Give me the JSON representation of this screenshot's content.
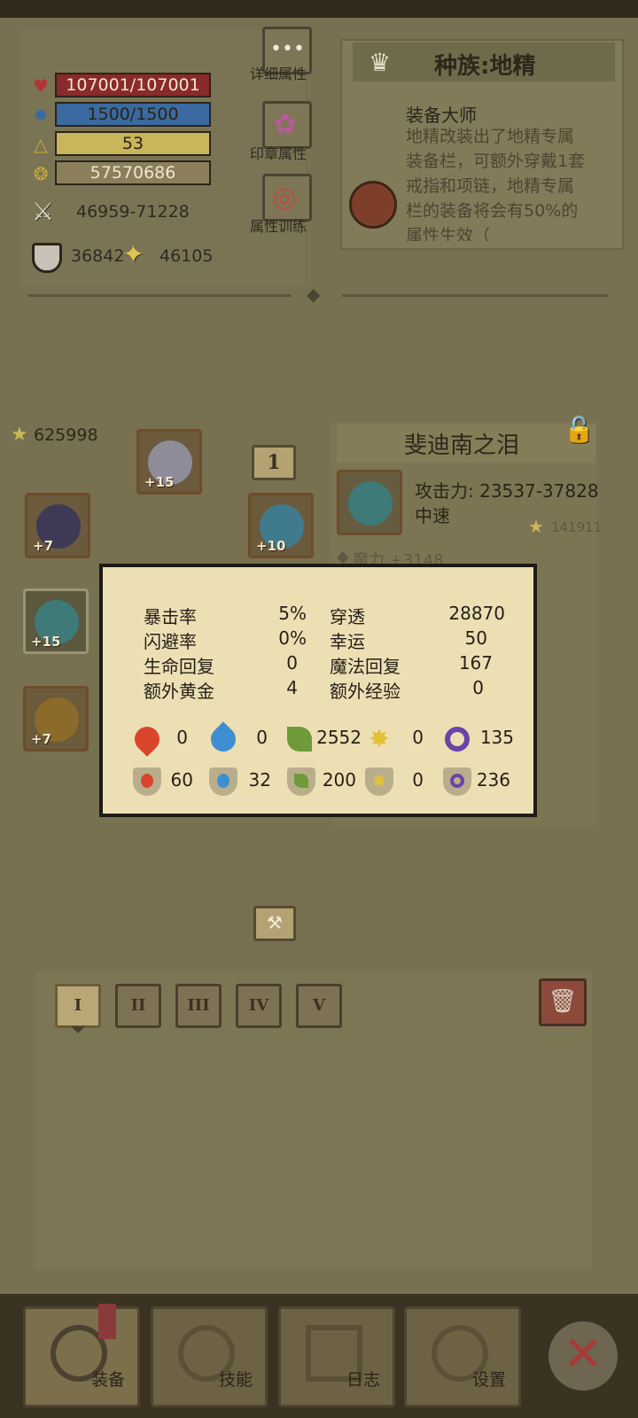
{
  "vitals": {
    "hp": "107001/107001",
    "mp": "1500/1500",
    "level": "53",
    "gold": "57570686",
    "attack": "46959-71228",
    "armor": "36842",
    "magic_resist": "46105"
  },
  "side_menu": {
    "detailed_label": "详细属性",
    "seal_label": "印章属性",
    "training_label": "属性训练"
  },
  "race": {
    "title": "种族:地精",
    "ability_name": "装备大师",
    "description": "地精改装出了地精专属装备栏，可额外穿戴1套戒指和项链，地精专属栏的装备将会有50%的属性生效（"
  },
  "gear": {
    "power_score": "625998",
    "slots": [
      {
        "name": "crown",
        "level": "+15"
      },
      {
        "name": "ring",
        "level": "+7"
      },
      {
        "name": "amulet",
        "level": "+10"
      },
      {
        "name": "staff",
        "level": "+15"
      },
      {
        "name": "boots",
        "level": "+7"
      }
    ],
    "set_number": "1"
  },
  "item": {
    "name": "斐迪南之泪",
    "attack": "攻击力: 23537-37828",
    "speed": "中速",
    "score": "141911",
    "bonus": "魔力 +3148"
  },
  "popup": {
    "stats": [
      {
        "label": "暴击率",
        "value": "5%",
        "label2": "穿透",
        "value2": "28870"
      },
      {
        "label": "闪避率",
        "value": "0%",
        "label2": "幸运",
        "value2": "50"
      },
      {
        "label": "生命回复",
        "value": "0",
        "label2": "魔法回复",
        "value2": "167"
      },
      {
        "label": "额外黄金",
        "value": "4",
        "label2": "额外经验",
        "value2": "0"
      }
    ],
    "element_damage": [
      {
        "element": "fire",
        "value": "0"
      },
      {
        "element": "water",
        "value": "0"
      },
      {
        "element": "nature",
        "value": "2552"
      },
      {
        "element": "light",
        "value": "0"
      },
      {
        "element": "dark",
        "value": "135"
      }
    ],
    "element_resist": [
      {
        "element": "fire",
        "value": "60"
      },
      {
        "element": "water",
        "value": "32"
      },
      {
        "element": "nature",
        "value": "200"
      },
      {
        "element": "light",
        "value": "0"
      },
      {
        "element": "dark",
        "value": "236"
      }
    ]
  },
  "inventory": {
    "tabs": [
      "I",
      "II",
      "III",
      "IV",
      "V"
    ],
    "selected_tab": "I"
  },
  "bottom_nav": {
    "equip": "装备",
    "skills": "技能",
    "log": "日志",
    "settings": "设置"
  },
  "colors": {
    "hp_bar": "#8a2a2a",
    "mp_bar": "#3a6aa0",
    "xp_bar": "#c9b55a",
    "gold_bar": "#8a7f5a",
    "fire": "#d8452a",
    "water": "#3d8fd2",
    "nature": "#6f9a3a",
    "light": "#e2c13a",
    "dark": "#6a45a8"
  }
}
